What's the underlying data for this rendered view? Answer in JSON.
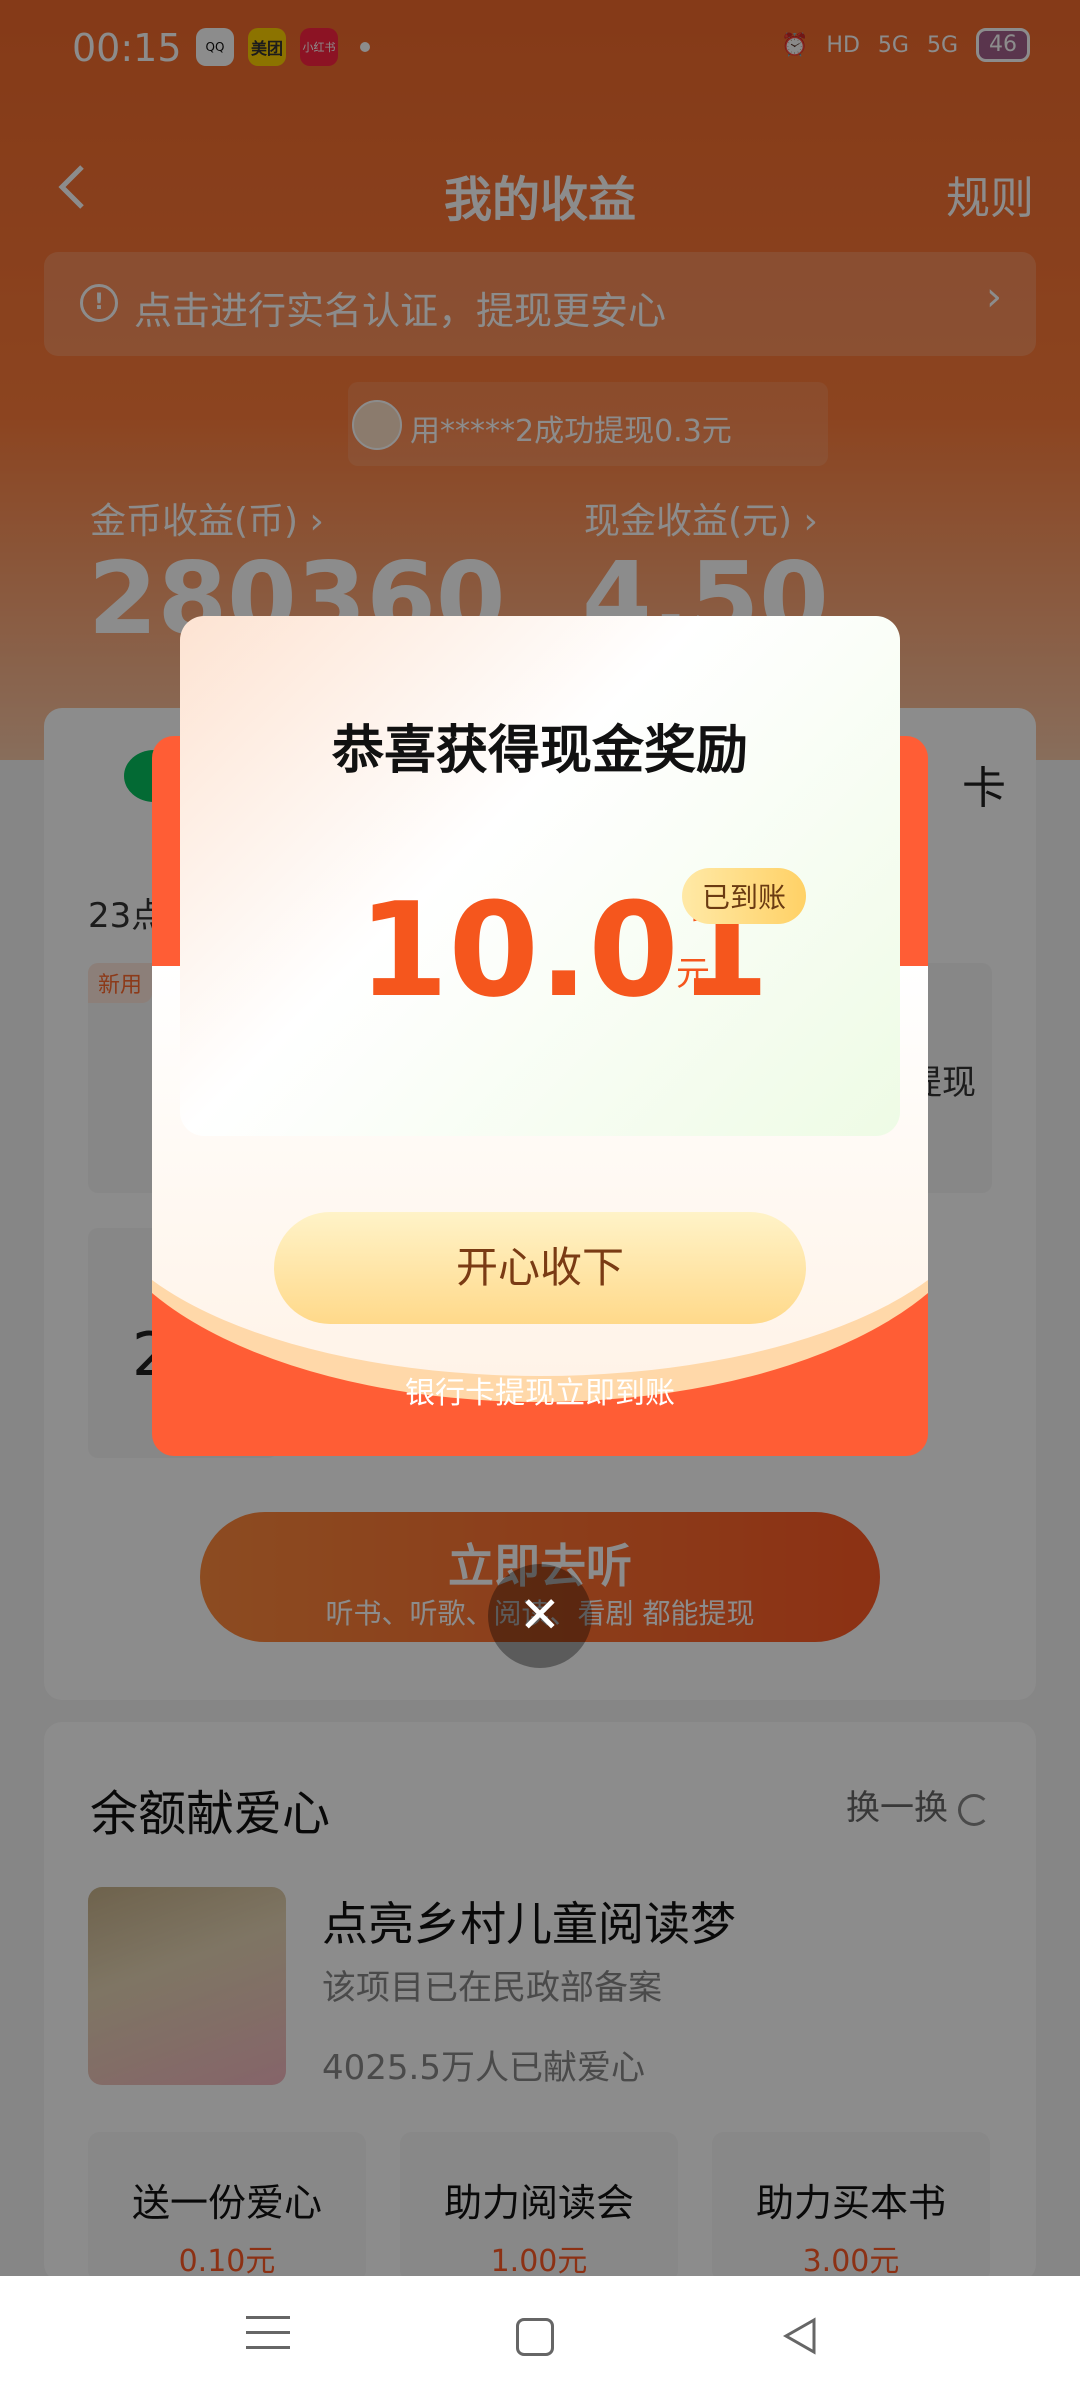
{
  "status_bar": {
    "time": "00:15",
    "apps": [
      "QQ",
      "美团",
      "小红书"
    ],
    "hd": "HD",
    "network_1": "5G",
    "network_2": "5G",
    "battery": "46"
  },
  "nav": {
    "title": "我的收益",
    "rules": "规则"
  },
  "verify_bar": {
    "text": "点击进行实名认证，提现更安心"
  },
  "ticker": {
    "text": "用*****2成功提现0.3元"
  },
  "earnings": {
    "coin_label": "金币收益(币) ›",
    "coin_value": "280360",
    "cash_label": "现金收益(元) ›",
    "cash_value": "4.50"
  },
  "withdraw": {
    "bank_label": "卡",
    "time_text": "23点",
    "newuser_badge": "新用",
    "right_tile_text": "提现",
    "mid_tile_num": "2",
    "listen_title": "立即去听",
    "listen_sub": "听书、听歌、阅读、看剧 都能提现"
  },
  "charity": {
    "title": "余额献爱心",
    "swap": "换一换",
    "project": "点亮乡村儿童阅读梦",
    "note": "该项目已在民政部备案",
    "count": "4025.5万人已献爱心",
    "options": [
      {
        "title": "送一份爱心",
        "amount": "0.10元"
      },
      {
        "title": "助力阅读会",
        "amount": "1.00元"
      },
      {
        "title": "助力买本书",
        "amount": "3.00元"
      }
    ]
  },
  "popup": {
    "title": "恭喜获得现金奖励",
    "amount": "10.01",
    "unit": "元",
    "badge": "已到账",
    "button": "开心收下",
    "sub": "银行卡提现立即到账"
  },
  "colors": {
    "brand_orange": "#ff5d35",
    "amount_orange": "#f5561d",
    "gold": "#ffd166"
  }
}
